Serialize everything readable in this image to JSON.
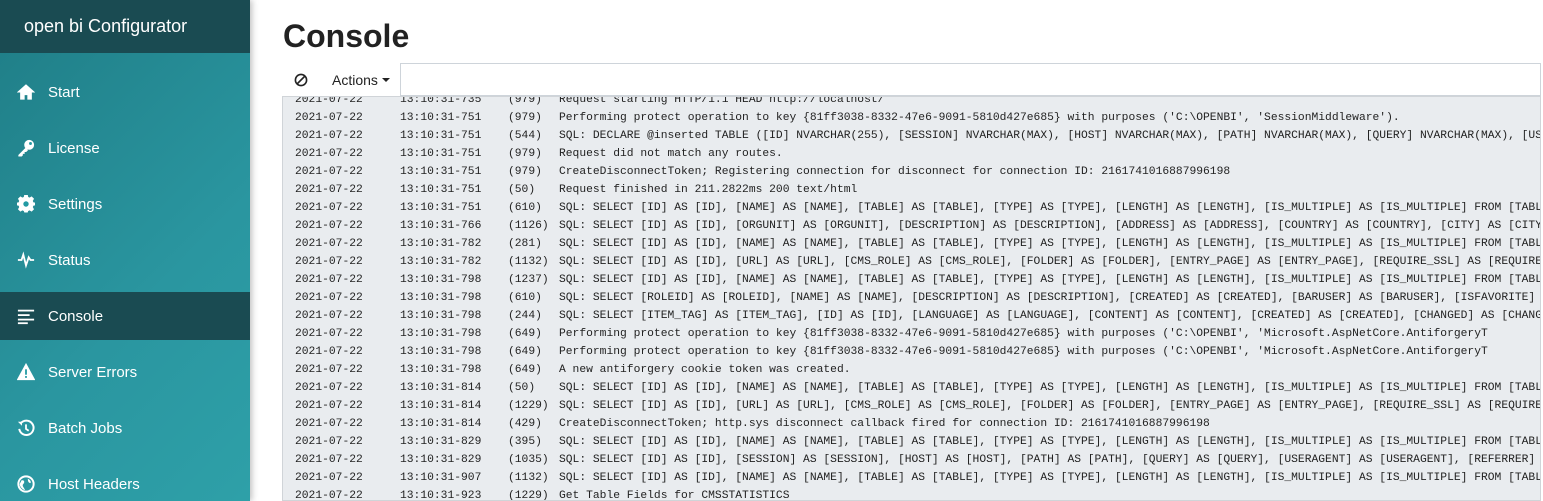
{
  "app_title": "open bi Configurator",
  "sidebar": {
    "items": [
      {
        "label": "Start",
        "icon": "home-icon",
        "active": false
      },
      {
        "label": "License",
        "icon": "key-icon",
        "active": false
      },
      {
        "label": "Settings",
        "icon": "gear-icon",
        "active": false
      },
      {
        "label": "Status",
        "icon": "heartbeat-icon",
        "active": false
      },
      {
        "label": "Console",
        "icon": "lines-icon",
        "active": true
      },
      {
        "label": "Server Errors",
        "icon": "warning-icon",
        "active": false
      },
      {
        "label": "Batch Jobs",
        "icon": "history-icon",
        "active": false
      },
      {
        "label": "Host Headers",
        "icon": "globe-icon",
        "active": false
      }
    ]
  },
  "page": {
    "title": "Console"
  },
  "toolbar": {
    "clear_icon": "ban-icon",
    "actions_label": "Actions",
    "filter_value": ""
  },
  "log": [
    {
      "date": "2021-07-22",
      "time": "13:10:31-735",
      "pid": "(979)",
      "msg": "Request starting HTTP/1.1 HEAD http://localhost/"
    },
    {
      "date": "2021-07-22",
      "time": "13:10:31-751",
      "pid": "(979)",
      "msg": "Performing protect operation to key {81ff3038-8332-47e6-9091-5810d427e685} with purposes ('C:\\OPENBI', 'SessionMiddleware')."
    },
    {
      "date": "2021-07-22",
      "time": "13:10:31-751",
      "pid": "(544)",
      "msg": "SQL: DECLARE @inserted TABLE ([ID] NVARCHAR(255), [SESSION] NVARCHAR(MAX), [HOST] NVARCHAR(MAX), [PATH] NVARCHAR(MAX), [QUERY] NVARCHAR(MAX), [USERAG"
    },
    {
      "date": "2021-07-22",
      "time": "13:10:31-751",
      "pid": "(979)",
      "msg": "Request did not match any routes."
    },
    {
      "date": "2021-07-22",
      "time": "13:10:31-751",
      "pid": "(979)",
      "msg": "CreateDisconnectToken; Registering connection for disconnect for connection ID: 2161741016887996198"
    },
    {
      "date": "2021-07-22",
      "time": "13:10:31-751",
      "pid": "(50)",
      "msg": "Request finished in 211.2822ms 200 text/html"
    },
    {
      "date": "2021-07-22",
      "time": "13:10:31-751",
      "pid": "(610)",
      "msg": "SQL: SELECT [ID] AS [ID], [NAME] AS [NAME], [TABLE] AS [TABLE], [TYPE] AS [TYPE], [LENGTH] AS [LENGTH], [IS_MULTIPLE] AS [IS_MULTIPLE] FROM [TABLEATT"
    },
    {
      "date": "2021-07-22",
      "time": "13:10:31-766",
      "pid": "(1126)",
      "msg": "SQL: SELECT [ID] AS [ID], [ORGUNIT] AS [ORGUNIT], [DESCRIPTION] AS [DESCRIPTION], [ADDRESS] AS [ADDRESS], [COUNTRY] AS [COUNTRY], [CITY] AS [CITY], ["
    },
    {
      "date": "2021-07-22",
      "time": "13:10:31-782",
      "pid": "(281)",
      "msg": "SQL: SELECT [ID] AS [ID], [NAME] AS [NAME], [TABLE] AS [TABLE], [TYPE] AS [TYPE], [LENGTH] AS [LENGTH], [IS_MULTIPLE] AS [IS_MULTIPLE] FROM [TABLEATT"
    },
    {
      "date": "2021-07-22",
      "time": "13:10:31-782",
      "pid": "(1132)",
      "msg": "SQL: SELECT [ID] AS [ID], [URL] AS [URL], [CMS_ROLE] AS [CMS_ROLE], [FOLDER] AS [FOLDER], [ENTRY_PAGE] AS [ENTRY_PAGE], [REQUIRE_SSL] AS [REQUIRE_SSL"
    },
    {
      "date": "2021-07-22",
      "time": "13:10:31-798",
      "pid": "(1237)",
      "msg": "SQL: SELECT [ID] AS [ID], [NAME] AS [NAME], [TABLE] AS [TABLE], [TYPE] AS [TYPE], [LENGTH] AS [LENGTH], [IS_MULTIPLE] AS [IS_MULTIPLE] FROM [TABLEATT"
    },
    {
      "date": "2021-07-22",
      "time": "13:10:31-798",
      "pid": "(610)",
      "msg": "SQL: SELECT [ROLEID] AS [ROLEID], [NAME] AS [NAME], [DESCRIPTION] AS [DESCRIPTION], [CREATED] AS [CREATED], [BARUSER] AS [BARUSER], [ISFAVORITE] AS ["
    },
    {
      "date": "2021-07-22",
      "time": "13:10:31-798",
      "pid": "(244)",
      "msg": "SQL: SELECT [ITEM_TAG] AS [ITEM_TAG], [ID] AS [ID], [LANGUAGE] AS [LANGUAGE], [CONTENT] AS [CONTENT], [CREATED] AS [CREATED], [CHANGED] AS [CHANGED],"
    },
    {
      "date": "2021-07-22",
      "time": "13:10:31-798",
      "pid": "(649)",
      "msg": "Performing protect operation to key {81ff3038-8332-47e6-9091-5810d427e685} with purposes ('C:\\OPENBI', 'Microsoft.AspNetCore.AntiforgeryT"
    },
    {
      "date": "2021-07-22",
      "time": "13:10:31-798",
      "pid": "(649)",
      "msg": "Performing protect operation to key {81ff3038-8332-47e6-9091-5810d427e685} with purposes ('C:\\OPENBI', 'Microsoft.AspNetCore.AntiforgeryT"
    },
    {
      "date": "2021-07-22",
      "time": "13:10:31-798",
      "pid": "(649)",
      "msg": "A new antiforgery cookie token was created."
    },
    {
      "date": "2021-07-22",
      "time": "13:10:31-814",
      "pid": "(50)",
      "msg": "SQL: SELECT [ID] AS [ID], [NAME] AS [NAME], [TABLE] AS [TABLE], [TYPE] AS [TYPE], [LENGTH] AS [LENGTH], [IS_MULTIPLE] AS [IS_MULTIPLE] FROM [TABLEATT"
    },
    {
      "date": "2021-07-22",
      "time": "13:10:31-814",
      "pid": "(1229)",
      "msg": "SQL: SELECT [ID] AS [ID], [URL] AS [URL], [CMS_ROLE] AS [CMS_ROLE], [FOLDER] AS [FOLDER], [ENTRY_PAGE] AS [ENTRY_PAGE], [REQUIRE_SSL] AS [REQUIRE_SSL"
    },
    {
      "date": "2021-07-22",
      "time": "13:10:31-814",
      "pid": "(429)",
      "msg": "CreateDisconnectToken; http.sys disconnect callback fired for connection ID: 2161741016887996198"
    },
    {
      "date": "2021-07-22",
      "time": "13:10:31-829",
      "pid": "(395)",
      "msg": "SQL: SELECT [ID] AS [ID], [NAME] AS [NAME], [TABLE] AS [TABLE], [TYPE] AS [TYPE], [LENGTH] AS [LENGTH], [IS_MULTIPLE] AS [IS_MULTIPLE] FROM [TABLEATT"
    },
    {
      "date": "2021-07-22",
      "time": "13:10:31-829",
      "pid": "(1035)",
      "msg": "SQL: SELECT [ID] AS [ID], [SESSION] AS [SESSION], [HOST] AS [HOST], [PATH] AS [PATH], [QUERY] AS [QUERY], [USERAGENT] AS [USERAGENT], [REFERRER] AS ["
    },
    {
      "date": "2021-07-22",
      "time": "13:10:31-907",
      "pid": "(1132)",
      "msg": "SQL: SELECT [ID] AS [ID], [NAME] AS [NAME], [TABLE] AS [TABLE], [TYPE] AS [TYPE], [LENGTH] AS [LENGTH], [IS_MULTIPLE] AS [IS_MULTIPLE] FROM [TABLEATT"
    },
    {
      "date": "2021-07-22",
      "time": "13:10:31-923",
      "pid": "(1229)",
      "msg": "Get Table Fields for CMSSTATISTICS"
    }
  ]
}
